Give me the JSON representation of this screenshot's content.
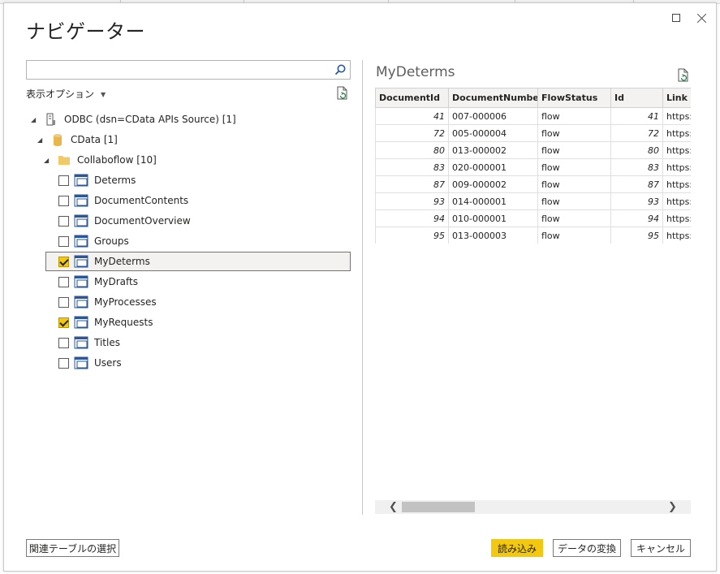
{
  "dialog": {
    "title": "ナビゲーター"
  },
  "search": {
    "value": "",
    "placeholder": ""
  },
  "options": {
    "label": "表示オプション"
  },
  "tree": {
    "source": "ODBC (dsn=CData APIs Source) [1]",
    "database": "CData [1]",
    "schema": "Collaboflow [10]",
    "tables": [
      {
        "label": "Determs",
        "checked": false
      },
      {
        "label": "DocumentContents",
        "checked": false
      },
      {
        "label": "DocumentOverview",
        "checked": false
      },
      {
        "label": "Groups",
        "checked": false
      },
      {
        "label": "MyDeterms",
        "checked": true
      },
      {
        "label": "MyDrafts",
        "checked": false
      },
      {
        "label": "MyProcesses",
        "checked": false
      },
      {
        "label": "MyRequests",
        "checked": true
      },
      {
        "label": "Titles",
        "checked": false
      },
      {
        "label": "Users",
        "checked": false
      }
    ]
  },
  "preview": {
    "title": "MyDeterms",
    "columns": [
      "DocumentId",
      "DocumentNumber",
      "FlowStatus",
      "Id",
      "Link"
    ],
    "rows": [
      [
        "41",
        "007-000006",
        "flow",
        "41",
        "https:/"
      ],
      [
        "72",
        "005-000004",
        "flow",
        "72",
        "https:/"
      ],
      [
        "80",
        "013-000002",
        "flow",
        "80",
        "https:/"
      ],
      [
        "83",
        "020-000001",
        "flow",
        "83",
        "https:/"
      ],
      [
        "87",
        "009-000002",
        "flow",
        "87",
        "https:/"
      ],
      [
        "93",
        "014-000001",
        "flow",
        "93",
        "https:/"
      ],
      [
        "94",
        "010-000001",
        "flow",
        "94",
        "https:/"
      ],
      [
        "95",
        "013-000003",
        "flow",
        "95",
        "https:/"
      ]
    ]
  },
  "footer": {
    "related": "関連テーブルの選択",
    "load": "読み込み",
    "transform": "データの変換",
    "cancel": "キャンセル"
  },
  "colors": {
    "accent": "#f2c811",
    "table_icon": "#2b579a",
    "folder": "#f0c96a",
    "db": "#e8b64c"
  }
}
